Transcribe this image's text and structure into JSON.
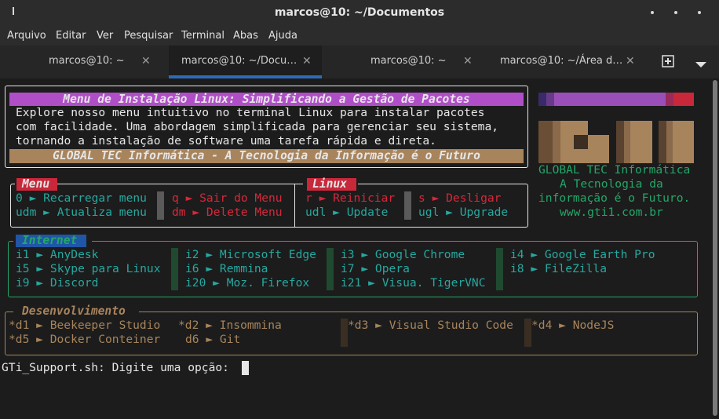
{
  "window": {
    "title": "marcos@10: ~/Documentos",
    "left_icon": "pin-icon",
    "controls": [
      "minimize-icon",
      "maximize-icon",
      "close-icon"
    ]
  },
  "menu": [
    "Arquivo",
    "Editar",
    "Ver",
    "Pesquisar",
    "Terminal",
    "Abas",
    "Ajuda"
  ],
  "tabs": [
    {
      "label": "marcos@10: ~",
      "active": false
    },
    {
      "label": "marcos@10: ~/Docu…",
      "active": true
    },
    {
      "label": "marcos@10: ~",
      "active": false
    },
    {
      "label": "marcos@10: ~/Área d…",
      "active": false
    }
  ],
  "tab_close_glyph": "✕",
  "terminal": {
    "header": {
      "title": "Menu de Instalação Linux: Simplificando a Gestão de Pacotes",
      "lines": [
        "Explore nosso menu intuitivo no terminal Linux para instalar pacotes",
        "com facilidade. Uma abordagem simplificada para gerenciar seu sistema,",
        "tornando a instalação de software uma tarefa rápida e direta."
      ],
      "footer": "GLOBAL TEC Informática - A Tecnologia da Informação é o Futuro"
    },
    "logo": {
      "lines": [
        "GLOBAL TEC Informática",
        "A Tecnologia da",
        "informação é o Futuro.",
        "www.gti1.com.br"
      ]
    },
    "menu_box": {
      "title_menu": "Menu",
      "title_linux": "Linux",
      "items": [
        "0 ► Recarregar menu",
        "udm ► Atualiza menu",
        "q ► Sair do Menu",
        "dm ► Delete Menu",
        "r ► Reiniciar",
        "udl ► Update",
        "s ► Desligar",
        "ugl ► Upgrade"
      ]
    },
    "internet": {
      "title": "Internet",
      "items": [
        "i1 ► AnyDesk",
        "i5 ► Skype para Linux",
        "i9 ► Discord",
        "i2 ► Microsoft Edge",
        "i6 ► Remmina",
        "i20 ► Moz. Firefox",
        "i3 ► Google Chrome",
        "i7 ► Opera",
        "i21 ► Visua. TigerVNC",
        "i4 ► Google Earth Pro",
        "i8 ► FileZilla"
      ]
    },
    "dev": {
      "title": "Desenvolvimento",
      "items": [
        "*d1 ► Beekeeper Studio",
        "*d5 ► Docker Conteiner",
        "*d2 ► Insommina",
        "d6 ► Git",
        "*d3 ► Visual Studio Code",
        "*d4 ► NodeJS"
      ]
    },
    "prompt": "GTi_Support.sh: Digite uma opção: "
  },
  "colors": {
    "cyan": "#26a8a0",
    "red": "#d7283a",
    "green": "#23a769",
    "brown": "#a8845c",
    "purple": "#b04ec8",
    "blue": "#1f56a6"
  }
}
